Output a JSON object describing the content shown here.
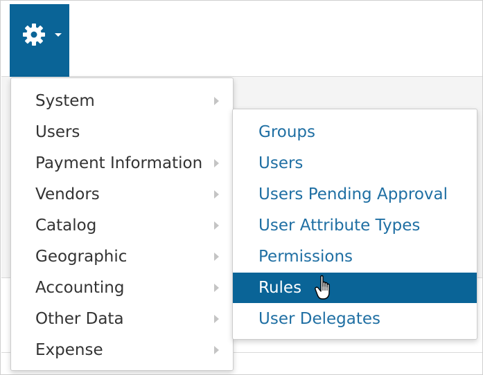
{
  "toolbar": {
    "gear_icon": "gear-icon",
    "caret_icon": "caret-down-icon",
    "accent_color": "#0a6497"
  },
  "menu": {
    "items": [
      {
        "label": "System",
        "has_submenu": true
      },
      {
        "label": "Users",
        "has_submenu": false
      },
      {
        "label": "Payment Information",
        "has_submenu": true
      },
      {
        "label": "Vendors",
        "has_submenu": true
      },
      {
        "label": "Catalog",
        "has_submenu": true
      },
      {
        "label": "Geographic",
        "has_submenu": true
      },
      {
        "label": "Accounting",
        "has_submenu": true
      },
      {
        "label": "Other Data",
        "has_submenu": true
      },
      {
        "label": "Expense",
        "has_submenu": true
      }
    ]
  },
  "submenu": {
    "items": [
      {
        "label": "Groups",
        "active": false
      },
      {
        "label": "Users",
        "active": false
      },
      {
        "label": "Users Pending Approval",
        "active": false
      },
      {
        "label": "User Attribute Types",
        "active": false
      },
      {
        "label": "Permissions",
        "active": false
      },
      {
        "label": "Rules",
        "active": true
      },
      {
        "label": "User Delegates",
        "active": false
      }
    ],
    "link_color": "#1f6fa3",
    "active_bg": "#0a6497"
  },
  "cursor": "hand-pointer-icon"
}
